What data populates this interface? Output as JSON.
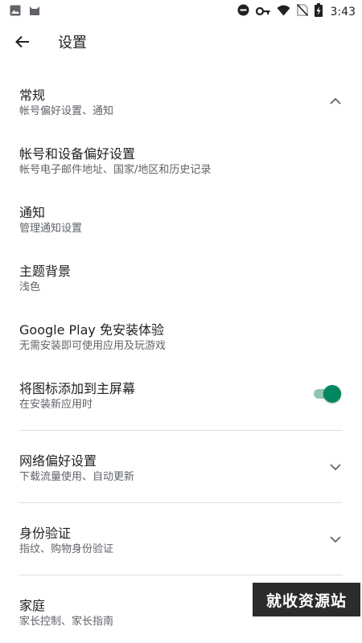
{
  "status_bar": {
    "time": "3:43",
    "icons": [
      "image-icon",
      "cat-icon",
      "do-not-disturb-icon",
      "key-icon",
      "wifi-icon",
      "no-sim-icon",
      "battery-charging-icon"
    ]
  },
  "header": {
    "title": "设置"
  },
  "sections": {
    "general": {
      "title": "常规",
      "subtitle": "帐号偏好设置、通知"
    },
    "account_device": {
      "title": "帐号和设备偏好设置",
      "subtitle": "帐号电子邮件地址、国家/地区和历史记录"
    },
    "notifications": {
      "title": "通知",
      "subtitle": "管理通知设置"
    },
    "theme": {
      "title": "主题背景",
      "subtitle": "浅色"
    },
    "instant": {
      "title": "Google Play 免安装体验",
      "subtitle": "无需安装即可使用应用及玩游戏"
    },
    "add_icon": {
      "title": "将图标添加到主屏幕",
      "subtitle": "在安装新应用时",
      "enabled": true
    },
    "network": {
      "title": "网络偏好设置",
      "subtitle": "下载流量使用、自动更新"
    },
    "auth": {
      "title": "身份验证",
      "subtitle": "指纹、购物身份验证"
    },
    "family": {
      "title": "家庭",
      "subtitle": "家长控制、家长指南"
    }
  },
  "watermark": {
    "text": "就收资源站"
  },
  "colors": {
    "accent": "#01875f",
    "accent_track": "#8fc7ae",
    "text": "#202124",
    "secondary_text": "#5f6368"
  }
}
